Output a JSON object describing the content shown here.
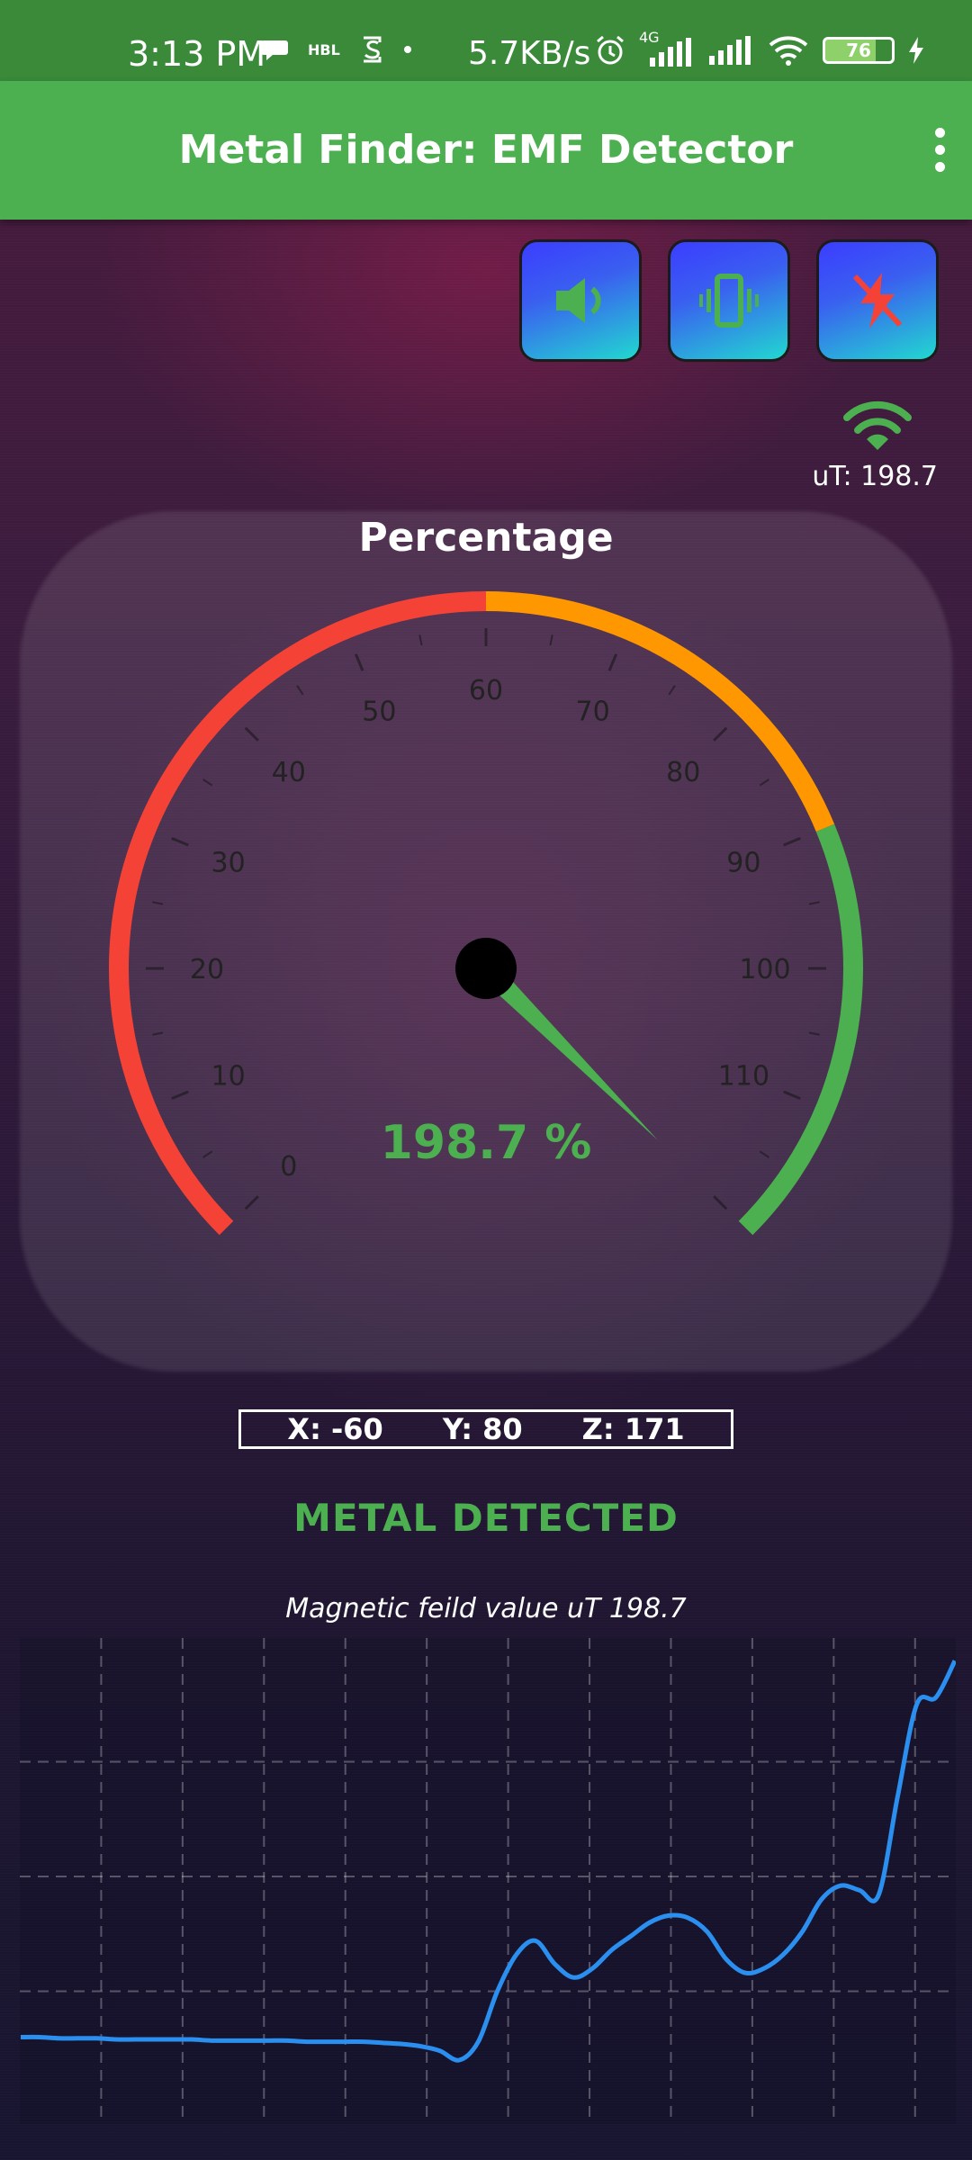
{
  "status_bar": {
    "time": "3:13 PM",
    "left_icons": [
      "chat-bubble-icon",
      "hbl-icon",
      "s-app-icon",
      "dot-icon"
    ],
    "hbl_label": "HBL",
    "network_speed": "5.7KB/s",
    "right_icons": [
      "alarm-icon",
      "4g-signal-icon",
      "signal-icon",
      "wifi-icon",
      "battery-icon",
      "charging-icon"
    ],
    "network_type": "4G",
    "battery_level": "76"
  },
  "app_bar": {
    "title": "Metal Finder: EMF Detector",
    "menu_icon": "more-vertical-icon"
  },
  "controls": {
    "sound_icon": "speaker-icon",
    "vibrate_icon": "vibrate-icon",
    "flash_icon": "flash-off-icon"
  },
  "readout": {
    "ut_text": "uT: 198.7",
    "signal_icon": "wifi-icon"
  },
  "gauge": {
    "title": "Percentage",
    "value_text": "198.7 %",
    "value": 198.7,
    "ticks": [
      "0",
      "10",
      "20",
      "30",
      "40",
      "50",
      "60",
      "70",
      "80",
      "90",
      "100",
      "110"
    ],
    "min": 0,
    "max": 120,
    "bands": [
      {
        "from": 0,
        "to": 60,
        "color": "#f44336"
      },
      {
        "from": 60,
        "to": 90,
        "color": "#ff9800"
      },
      {
        "from": 90,
        "to": 120,
        "color": "#4caf50"
      }
    ],
    "needle_color": "#4caf50"
  },
  "axes": {
    "x": "X: -60",
    "y": "Y: 80",
    "z": "Z: 171"
  },
  "status_message": "METAL  DETECTED",
  "chart_caption": "Magnetic feild value uT 198.7",
  "chart_data": {
    "type": "line",
    "title": "",
    "xlabel": "",
    "ylabel": "",
    "grid": true,
    "ylim": [
      0,
      200
    ],
    "series": [
      {
        "color": "#2b8ff0",
        "x": [
          0,
          1,
          2,
          3,
          4,
          5,
          6,
          7,
          8,
          9,
          10,
          11,
          12,
          13,
          14,
          15,
          16,
          17,
          18,
          19,
          20,
          21,
          22,
          23,
          24,
          25,
          26,
          27,
          28,
          29,
          30,
          31,
          32,
          33,
          34,
          35,
          36,
          37,
          38,
          39,
          40,
          41,
          42,
          43,
          44,
          45,
          46,
          47,
          48,
          49
        ],
        "values": [
          30,
          30,
          29.5,
          29.5,
          29.5,
          29,
          29,
          29,
          29,
          29,
          28.5,
          28.5,
          28.5,
          28.5,
          28.5,
          28,
          28,
          28,
          28,
          27.5,
          27,
          26,
          24,
          20,
          28,
          50,
          66,
          72,
          62,
          56,
          60,
          68,
          74,
          80,
          83,
          82,
          76,
          64,
          58,
          60,
          66,
          76,
          90,
          96,
          94,
          92,
          135,
          175,
          178,
          194
        ]
      }
    ]
  }
}
